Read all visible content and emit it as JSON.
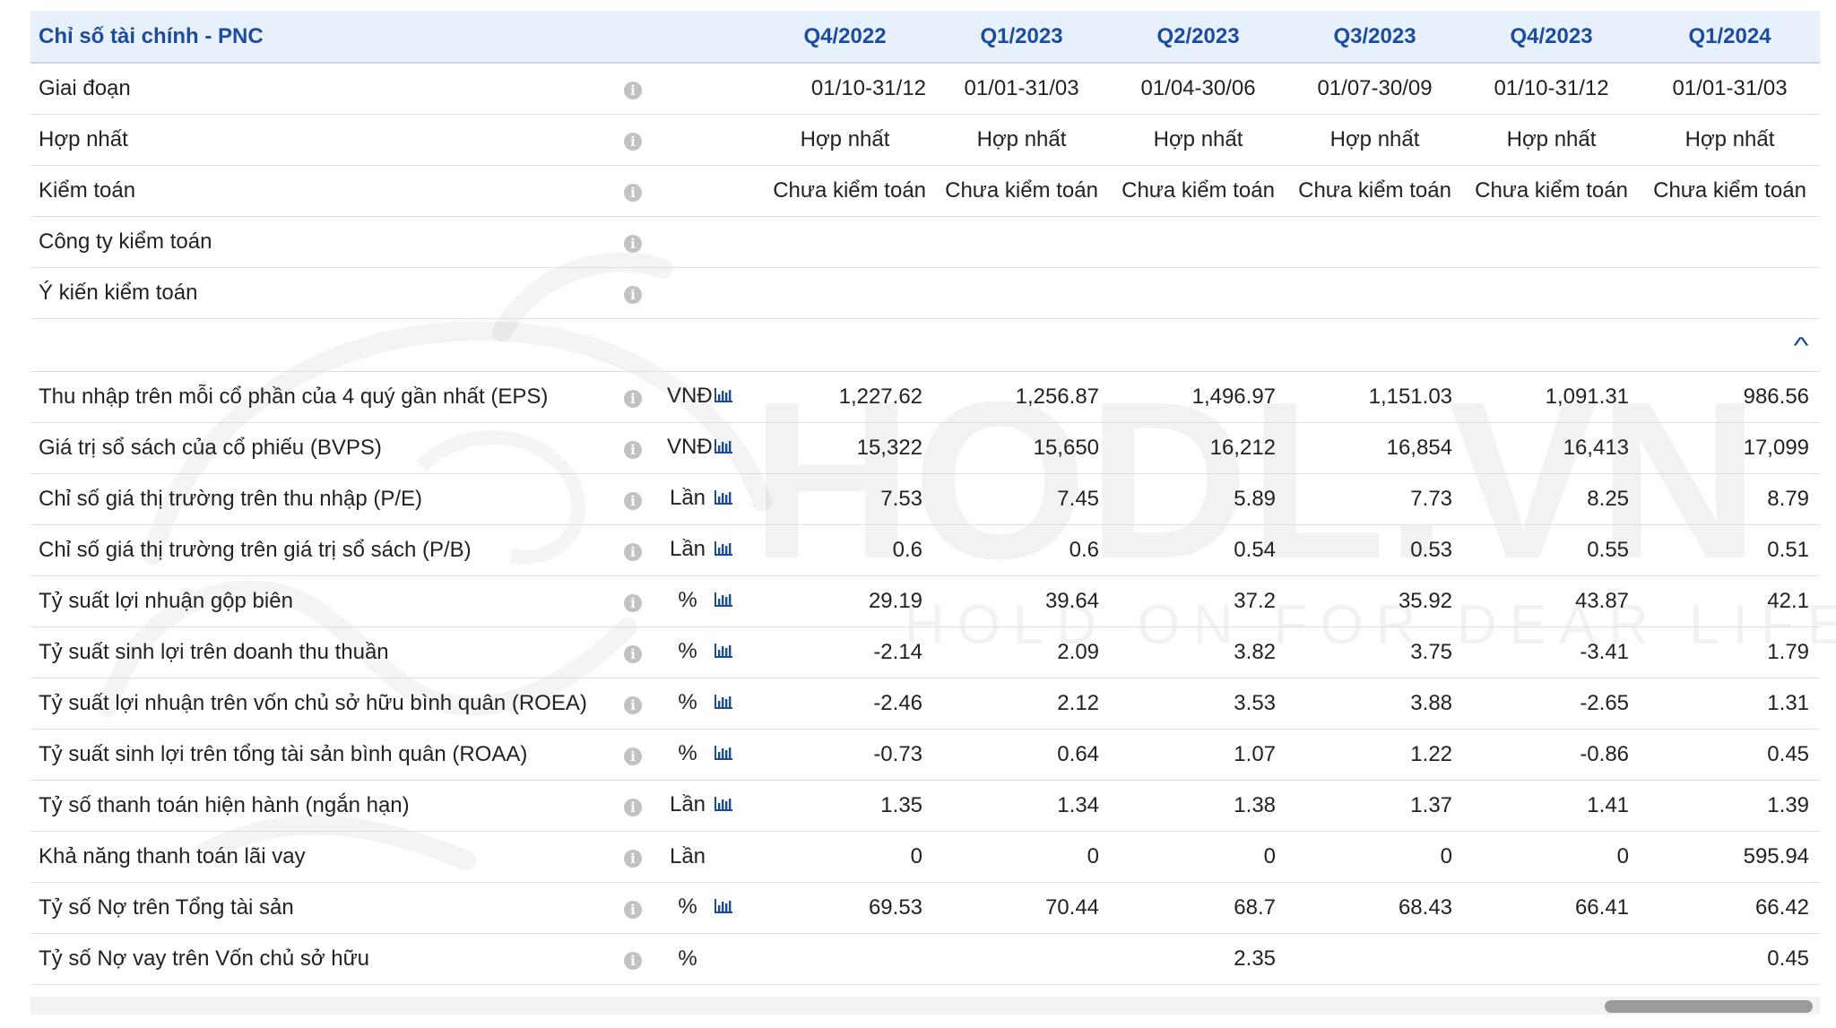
{
  "watermark": {
    "brand": "HODL.VN",
    "tagline": "HOLD ON FOR DEAR LIFE"
  },
  "table_title": "Chỉ số tài chính - PNC",
  "quarters": [
    "Q4/2022",
    "Q1/2023",
    "Q2/2023",
    "Q3/2023",
    "Q4/2023",
    "Q1/2024"
  ],
  "info_rows": [
    {
      "label": "Giai đoạn",
      "values": [
        "01/10-31/12",
        "01/01-31/03",
        "01/04-30/06",
        "01/07-30/09",
        "01/10-31/12",
        "01/01-31/03"
      ]
    },
    {
      "label": "Hợp nhất",
      "values": [
        "Hợp nhất",
        "Hợp nhất",
        "Hợp nhất",
        "Hợp nhất",
        "Hợp nhất",
        "Hợp nhất"
      ]
    },
    {
      "label": "Kiểm toán",
      "values": [
        "Chưa kiểm toán",
        "Chưa kiểm toán",
        "Chưa kiểm toán",
        "Chưa kiểm toán",
        "Chưa kiểm toán",
        "Chưa kiểm toán"
      ]
    },
    {
      "label": "Công ty kiểm toán",
      "values": [
        "",
        "",
        "",
        "",
        "",
        ""
      ]
    },
    {
      "label": "Ý kiến kiểm toán",
      "values": [
        "",
        "",
        "",
        "",
        "",
        ""
      ]
    }
  ],
  "metric_rows": [
    {
      "label": "Thu nhập trên mỗi cổ phần của 4 quý gần nhất (EPS)",
      "unit": "VNĐ",
      "values": [
        "1,227.62",
        "1,256.87",
        "1,496.97",
        "1,151.03",
        "1,091.31",
        "986.56"
      ]
    },
    {
      "label": "Giá trị sổ sách của cổ phiếu (BVPS)",
      "unit": "VNĐ",
      "values": [
        "15,322",
        "15,650",
        "16,212",
        "16,854",
        "16,413",
        "17,099"
      ]
    },
    {
      "label": "Chỉ số giá thị trường trên thu nhập (P/E)",
      "unit": "Lần",
      "values": [
        "7.53",
        "7.45",
        "5.89",
        "7.73",
        "8.25",
        "8.79"
      ]
    },
    {
      "label": "Chỉ số giá thị trường trên giá trị sổ sách (P/B)",
      "unit": "Lần",
      "values": [
        "0.6",
        "0.6",
        "0.54",
        "0.53",
        "0.55",
        "0.51"
      ]
    },
    {
      "label": "Tỷ suất lợi nhuận gộp biên",
      "unit": "%",
      "values": [
        "29.19",
        "39.64",
        "37.2",
        "35.92",
        "43.87",
        "42.1"
      ]
    },
    {
      "label": "Tỷ suất sinh lợi trên doanh thu thuần",
      "unit": "%",
      "values": [
        "-2.14",
        "2.09",
        "3.82",
        "3.75",
        "-3.41",
        "1.79"
      ]
    },
    {
      "label": "Tỷ suất lợi nhuận trên vốn chủ sở hữu bình quân (ROEA)",
      "unit": "%",
      "values": [
        "-2.46",
        "2.12",
        "3.53",
        "3.88",
        "-2.65",
        "1.31"
      ]
    },
    {
      "label": "Tỷ suất sinh lợi trên tổng tài sản bình quân (ROAA)",
      "unit": "%",
      "values": [
        "-0.73",
        "0.64",
        "1.07",
        "1.22",
        "-0.86",
        "0.45"
      ]
    },
    {
      "label": "Tỷ số thanh toán hiện hành (ngắn hạn)",
      "unit": "Lần",
      "values": [
        "1.35",
        "1.34",
        "1.38",
        "1.37",
        "1.41",
        "1.39"
      ]
    },
    {
      "label": "Khả năng thanh toán lãi vay",
      "unit": "Lần",
      "values": [
        "0",
        "0",
        "0",
        "0",
        "0",
        "595.94"
      ]
    },
    {
      "label": "Tỷ số Nợ trên Tổng tài sản",
      "unit": "%",
      "values": [
        "69.53",
        "70.44",
        "68.7",
        "68.43",
        "66.41",
        "66.42"
      ]
    },
    {
      "label": "Tỷ số Nợ vay trên Vốn chủ sở hữu",
      "unit": "%",
      "values": [
        "",
        "",
        "2.35",
        "",
        "",
        "0.45"
      ]
    }
  ],
  "icons": {
    "info": "info-icon",
    "chart": "bar-chart-icon",
    "collapse": "chevron-up-icon"
  },
  "colors": {
    "header_bg": "#e8f0fb",
    "header_text": "#1b4d9c",
    "chart_icon": "#1b4d9c"
  }
}
